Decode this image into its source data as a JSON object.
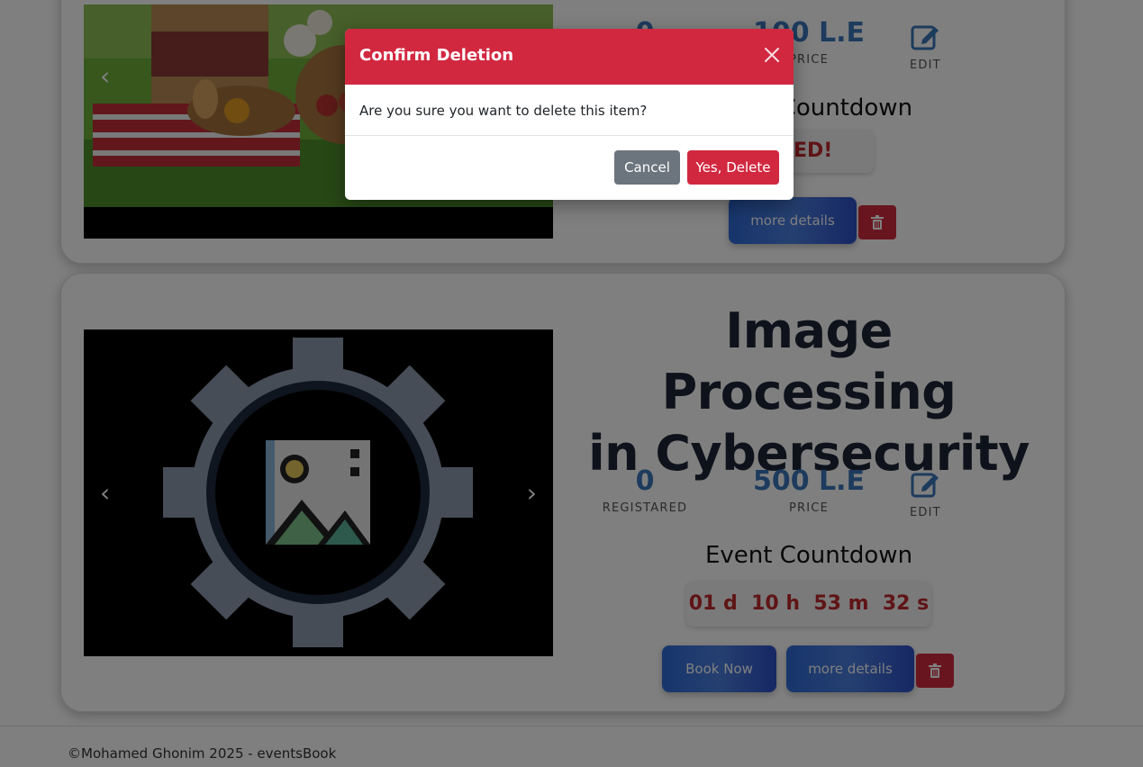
{
  "events": [
    {
      "registered_count": "0",
      "price": "100 L.E",
      "price_label": "PRICE",
      "edit_label": "EDIT",
      "countdown_title": "Event Countdown",
      "countdown_text": "EXPIRED!",
      "more_details_label": "more details"
    },
    {
      "title_line1": "Image Processing",
      "title_line2": "in Cybersecurity",
      "registered_count": "0",
      "registered_label": "REGISTARED",
      "price": "500 L.E",
      "price_label": "PRICE",
      "edit_label": "EDIT",
      "countdown_title": "Event Countdown",
      "countdown": "01 d  10 h  53 m  32 s",
      "book_now_label": "Book Now",
      "more_details_label": "more details"
    }
  ],
  "carousel": {
    "prev_icon": "chevron-left-icon",
    "next_icon": "chevron-right-icon"
  },
  "footer": {
    "text": "©Mohamed Ghonim 2025 - eventsBook"
  },
  "modal": {
    "title": "Confirm Deletion",
    "message": "Are you sure you want to delete this item?",
    "cancel_label": "Cancel",
    "confirm_label": "Yes, Delete",
    "close_icon": "close-icon"
  },
  "colors": {
    "danger": "#d12840",
    "secondary": "#6c757d",
    "price_blue": "#3a76ba",
    "countdown_red": "#c0282d",
    "title_navy": "#1c2536"
  }
}
